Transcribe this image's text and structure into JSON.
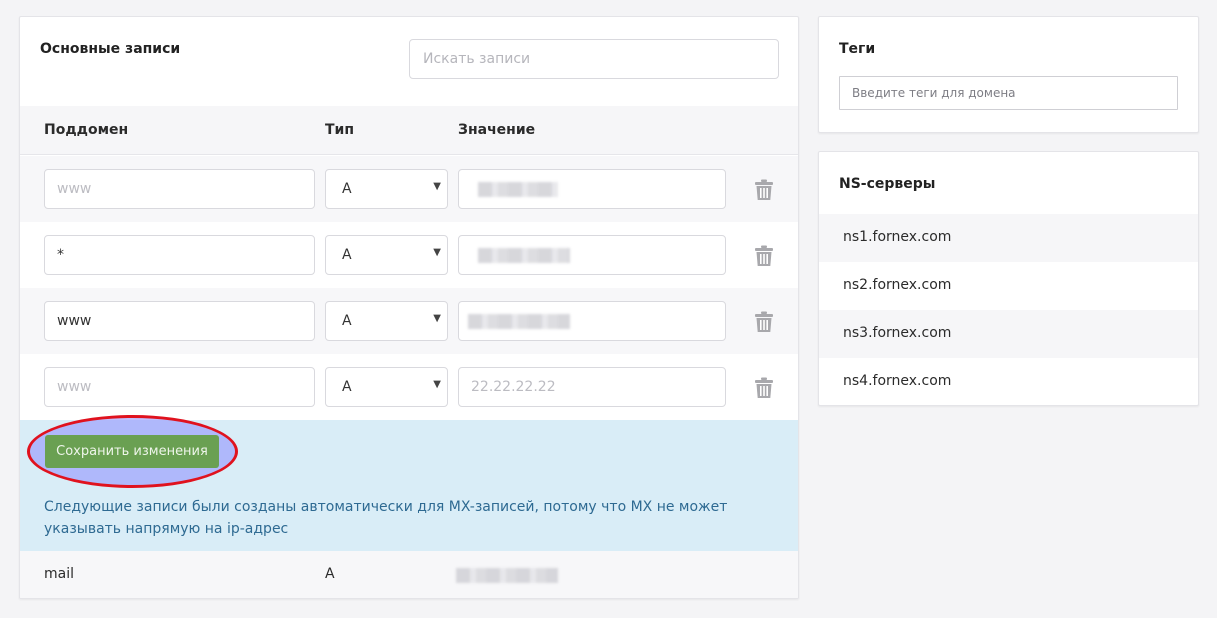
{
  "records_panel": {
    "title": "Основные записи",
    "search": {
      "placeholder": "Искать записи",
      "value": ""
    },
    "columns": {
      "subdomain": "Поддомен",
      "type": "Тип",
      "value": "Значение"
    },
    "rows": [
      {
        "subdomain": "",
        "subdomain_placeholder": "www",
        "type": "A",
        "value": "",
        "value_placeholder": "",
        "value_redacted": true
      },
      {
        "subdomain": "*",
        "subdomain_placeholder": "",
        "type": "A",
        "value": "",
        "value_placeholder": "",
        "value_redacted": true
      },
      {
        "subdomain": "www",
        "subdomain_placeholder": "",
        "type": "A",
        "value": "",
        "value_placeholder": "",
        "value_redacted": true
      },
      {
        "subdomain": "",
        "subdomain_placeholder": "www",
        "type": "A",
        "value": "",
        "value_placeholder": "22.22.22.22",
        "value_redacted": false
      }
    ],
    "save_label": "Сохранить изменения",
    "info_text": "Следующие записи были созданы автоматически для MX-записей, потому что MX не может указывать напрямую на ip-адрес",
    "auto_record": {
      "subdomain": "mail",
      "type": "A",
      "value_redacted": true
    }
  },
  "tags_panel": {
    "title": "Теги",
    "input_placeholder": "Введите теги для домена",
    "input_value": ""
  },
  "ns_panel": {
    "title": "NS-серверы",
    "servers": [
      "ns1.fornex.com",
      "ns2.fornex.com",
      "ns3.fornex.com",
      "ns4.fornex.com"
    ]
  },
  "colors": {
    "save_button": "#6aa052",
    "info_background": "#d9edf7",
    "info_text": "#2e6a92",
    "annotation_outline": "#e0121e"
  },
  "icons": {
    "delete": "trash-icon",
    "select": "chevron-down-icon"
  }
}
